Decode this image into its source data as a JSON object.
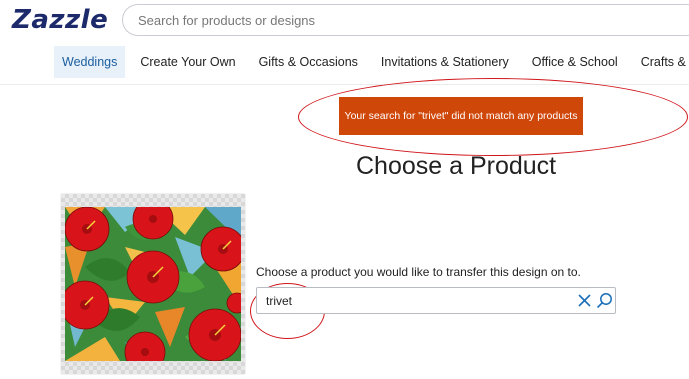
{
  "header": {
    "logo_text": "Zazzle",
    "search_placeholder": "Search for products or designs"
  },
  "nav": {
    "items": [
      {
        "label": "Weddings",
        "active": true
      },
      {
        "label": "Create Your Own"
      },
      {
        "label": "Gifts & Occasions"
      },
      {
        "label": "Invitations & Stationery"
      },
      {
        "label": "Office & School"
      },
      {
        "label": "Crafts & Par"
      }
    ]
  },
  "error_banner": {
    "text": "Your search for \"trivet\" did not match any products",
    "color": "#d0470a"
  },
  "main": {
    "heading": "Choose a Product",
    "prompt": "Choose a product you would like to transfer this design on to.",
    "product_search_value": "trivet"
  },
  "design": {
    "description": "stained-glass red hibiscus pattern",
    "colors": [
      "#d8141a",
      "#2f8a2a",
      "#f0a02a",
      "#6fbfd8"
    ]
  },
  "annotation_color": "#d0161b",
  "icons": [
    "clear-icon",
    "search-icon"
  ]
}
